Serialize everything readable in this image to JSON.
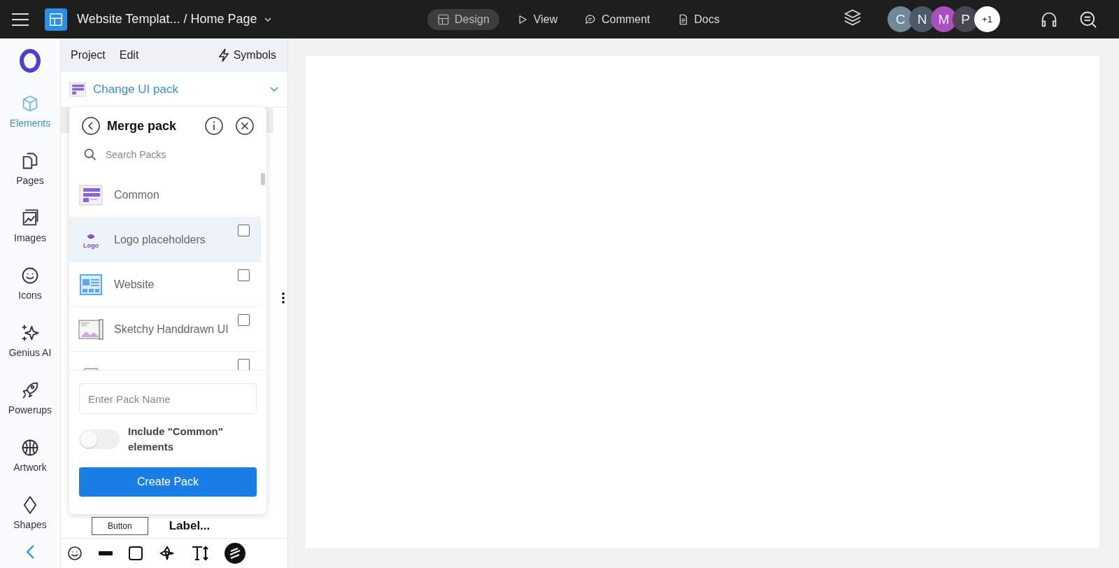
{
  "topbar": {
    "title": "Website Templat... / Home Page",
    "modes": [
      {
        "label": "Design",
        "selected": true
      },
      {
        "label": "View",
        "selected": false
      },
      {
        "label": "Comment",
        "selected": false
      },
      {
        "label": "Docs",
        "selected": false
      }
    ],
    "avatars": [
      {
        "initial": "C",
        "color": "#6e8a99"
      },
      {
        "initial": "N",
        "color": "#4a5a66"
      },
      {
        "initial": "M",
        "color": "#a94fc0"
      },
      {
        "initial": "P",
        "color": "#4a4552"
      },
      {
        "initial": "+1",
        "color": "#ffffff"
      }
    ]
  },
  "rail": {
    "items": [
      {
        "label": "Elements",
        "selected": true
      },
      {
        "label": "Pages",
        "selected": false
      },
      {
        "label": "Images",
        "selected": false
      },
      {
        "label": "Icons",
        "selected": false
      },
      {
        "label": "Genius AI",
        "selected": false
      },
      {
        "label": "Powerups",
        "selected": false
      },
      {
        "label": "Artwork",
        "selected": false
      },
      {
        "label": "Shapes",
        "selected": false
      }
    ]
  },
  "panel": {
    "menu": [
      "Project",
      "Edit"
    ],
    "symbols": "Symbols",
    "ui_pack": "Change UI pack",
    "canvas_items": [
      {
        "kind": "button",
        "text": "Button"
      },
      {
        "kind": "label",
        "text": "Label..."
      }
    ]
  },
  "merge_pack": {
    "title": "Merge pack",
    "search": {
      "placeholder": "Search Packs"
    },
    "packs": [
      {
        "name": "Common",
        "kind": "base",
        "hovered": false
      },
      {
        "name": "Logo placeholders",
        "thumbnail_text": "Logo",
        "kind": "option",
        "checked": false,
        "hovered": true
      },
      {
        "name": "Website",
        "kind": "option",
        "checked": false,
        "hovered": false
      },
      {
        "name": "Sketchy Handdrawn UI",
        "kind": "option",
        "checked": false,
        "hovered": false
      },
      {
        "kind": "option",
        "checked": false,
        "hovered": false
      }
    ],
    "name_field": {
      "placeholder": "Enter Pack Name"
    },
    "include_common": {
      "label": "Include \"Common\" elements",
      "on": false
    },
    "create_button": "Create Pack"
  }
}
